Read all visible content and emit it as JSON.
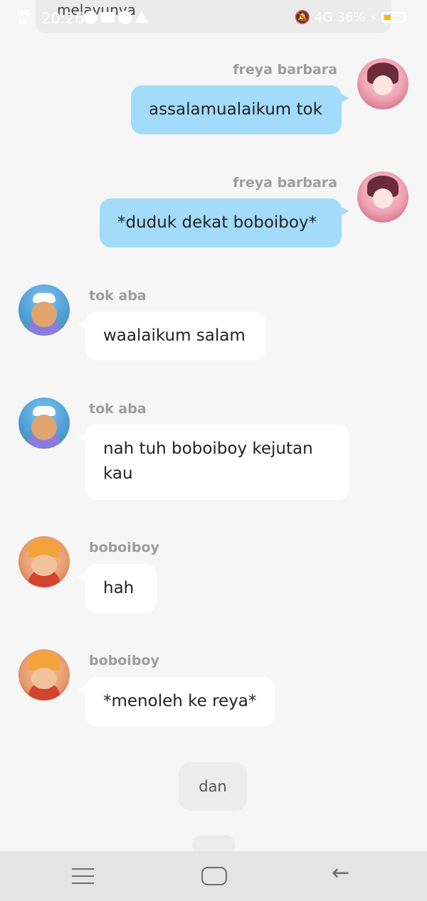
{
  "header": {
    "title": "melayunya"
  },
  "status_bar": {
    "time": "20:26",
    "network": "4G",
    "battery": "36%",
    "battery_level": 0.36,
    "accent": "#f5b800"
  },
  "messages": [
    {
      "sender": "freya barbara",
      "text": "assalamualaikum tok",
      "side": "right",
      "avatar": "freya-avatar"
    },
    {
      "sender": "freya barbara",
      "text": "*duduk dekat boboiboy*",
      "side": "right",
      "avatar": "freya-avatar"
    },
    {
      "sender": "tok aba",
      "text": "waalaikum salam",
      "side": "left",
      "avatar": "tok-aba-avatar"
    },
    {
      "sender": "tok aba",
      "text": "nah tuh boboiboy kejutan kau",
      "side": "left",
      "avatar": "tok-aba-avatar"
    },
    {
      "sender": "boboiboy",
      "text": "hah",
      "side": "left",
      "avatar": "boboiboy-avatar"
    },
    {
      "sender": "boboiboy",
      "text": "*menoleh ke reya*",
      "side": "left",
      "avatar": "boboiboy-avatar"
    }
  ],
  "narration": {
    "text": "dan"
  },
  "colors": {
    "user_bubble": "#a3dcfb",
    "other_bubble": "#ffffff",
    "background": "#f6f6f6"
  },
  "nav": {
    "icons": [
      "menu-icon",
      "home-icon",
      "back-icon"
    ]
  }
}
